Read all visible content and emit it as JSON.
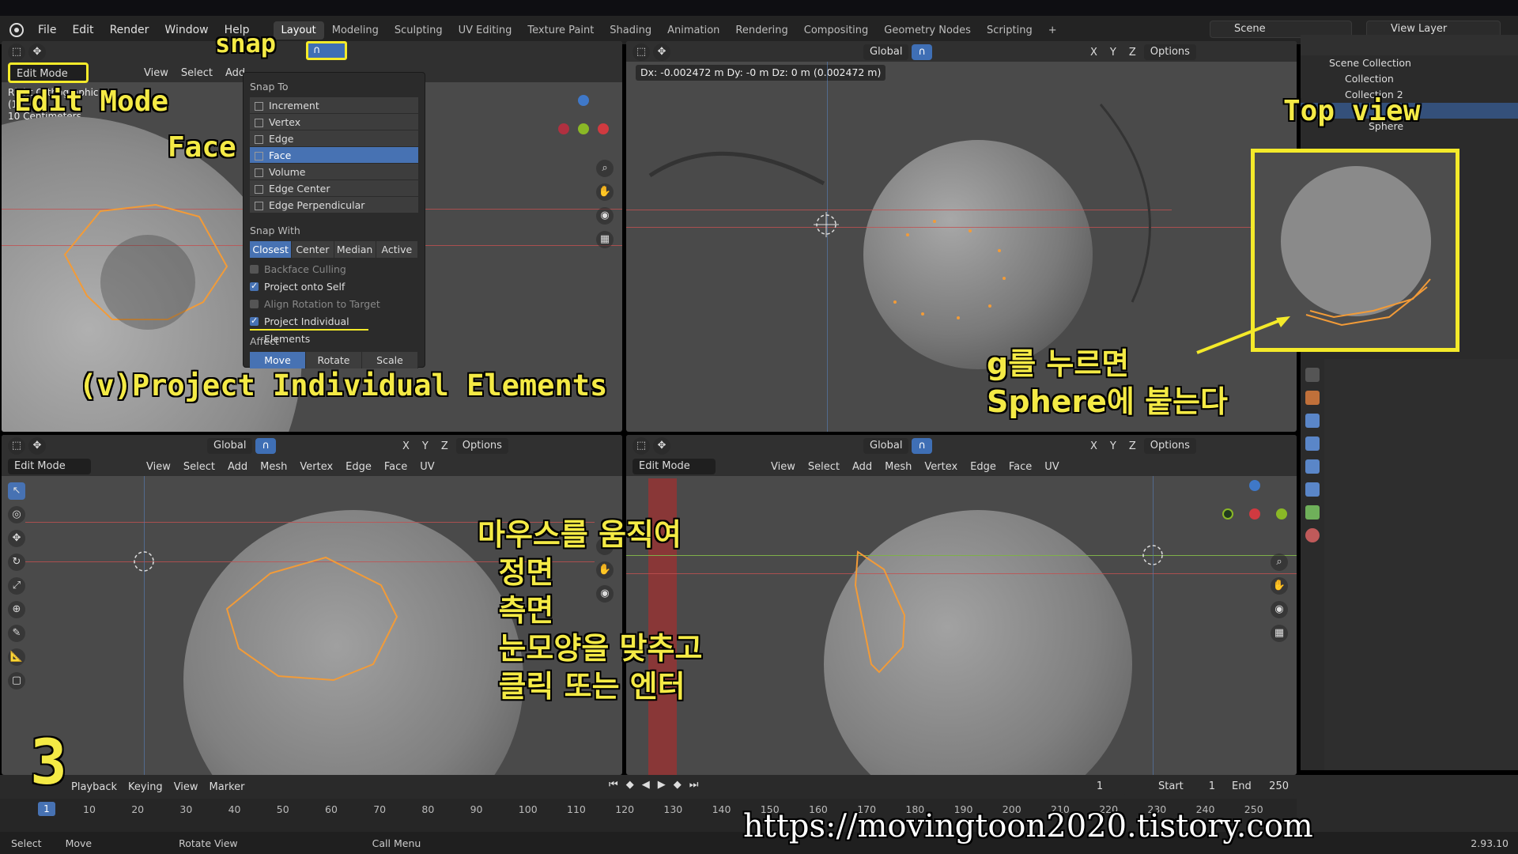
{
  "topbar": {
    "menus": [
      "File",
      "Edit",
      "Render",
      "Window",
      "Help"
    ],
    "workspaces": [
      "Layout",
      "Modeling",
      "Sculpting",
      "UV Editing",
      "Texture Paint",
      "Shading",
      "Animation",
      "Rendering",
      "Compositing",
      "Geometry Nodes",
      "Scripting"
    ],
    "active_workspace": "Layout",
    "add_tab": "+",
    "scene": "Scene",
    "view_layer": "View Layer"
  },
  "viewport_header": {
    "mode": "Edit Mode",
    "menus": [
      "View",
      "Select",
      "Add",
      "Mesh",
      "Vertex",
      "Edge",
      "Face",
      "UV"
    ],
    "orientation": "Global",
    "options": "Options",
    "axes": [
      "X",
      "Y",
      "Z"
    ]
  },
  "top_left_info": {
    "line1": "Right Orthographic",
    "line2": "(1)",
    "line3": "10 Centimeters"
  },
  "transform_readout": "Dx: -0.002472 m  Dy: -0 m  Dz: 0 m (0.002472 m)",
  "snap_popup": {
    "snap_to_title": "Snap To",
    "snap_to": [
      "Increment",
      "Vertex",
      "Edge",
      "Face",
      "Volume",
      "Edge Center",
      "Edge Perpendicular"
    ],
    "snap_to_active": "Face",
    "snap_with_title": "Snap With",
    "snap_with": [
      "Closest",
      "Center",
      "Median",
      "Active"
    ],
    "snap_with_active": "Closest",
    "checkboxes": [
      {
        "label": "Backface Culling",
        "checked": false
      },
      {
        "label": "Project onto Self",
        "checked": true
      },
      {
        "label": "Align Rotation to Target",
        "checked": false
      },
      {
        "label": "Project Individual Elements",
        "checked": true
      }
    ],
    "affect_title": "Affect",
    "affect": [
      "Move",
      "Rotate",
      "Scale"
    ],
    "affect_active": "Move"
  },
  "outliner": {
    "root": "Scene Collection",
    "items": [
      "Collection",
      "Collection 2",
      "Sphere"
    ]
  },
  "timeline": {
    "menus": [
      "Playback",
      "Keying",
      "View",
      "Marker"
    ],
    "current_frame": "1",
    "start_label": "Start",
    "start": "1",
    "end_label": "End",
    "end": "250",
    "ticks": [
      "1",
      "10",
      "20",
      "30",
      "40",
      "50",
      "60",
      "70",
      "80",
      "90",
      "100",
      "110",
      "120",
      "130",
      "140",
      "150",
      "160",
      "170",
      "180",
      "190",
      "200",
      "210",
      "220",
      "230",
      "240",
      "250"
    ]
  },
  "statusbar": {
    "select": "Select",
    "move": "Move",
    "rotate": "Rotate View",
    "call_menu": "Call Menu",
    "version": "2.93.10"
  },
  "annotations": {
    "snap": "snap",
    "edit_mode": "Edit Mode",
    "face": "Face",
    "project": "(v)Project Individual Elements",
    "top_view": "Top view",
    "g_press": "g를 누르면\nSphere에 붙는다",
    "mouse_move": "마우스를 움직여\n  정면\n  측면\n  눈모양을 맞추고\n  클릭 또는 엔터",
    "step": "3",
    "url": "https://movingtoon2020.tistory.com"
  },
  "colors": {
    "accent": "#4772b3",
    "annotation": "#f4ea45",
    "edge_select": "#f29b38"
  }
}
